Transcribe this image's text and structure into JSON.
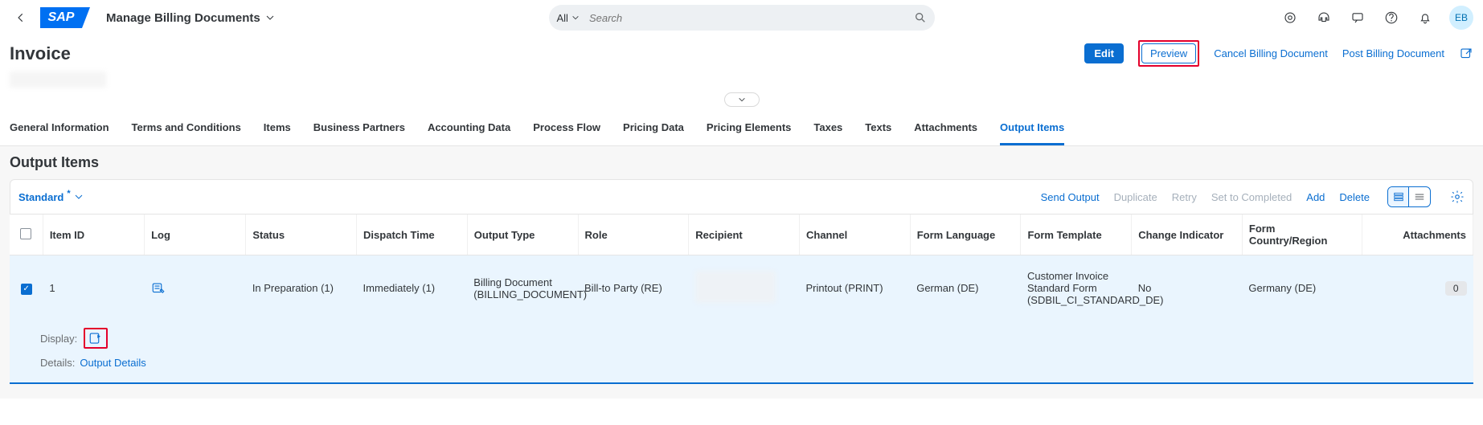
{
  "shell": {
    "logo_text": "SAP",
    "app_title": "Manage Billing Documents",
    "search_filter": "All",
    "search_placeholder": "Search",
    "avatar_initials": "EB"
  },
  "page": {
    "title": "Invoice"
  },
  "header_actions": {
    "edit": "Edit",
    "preview": "Preview",
    "cancel": "Cancel Billing Document",
    "post": "Post Billing Document"
  },
  "tabs": [
    "General Information",
    "Terms and Conditions",
    "Items",
    "Business Partners",
    "Accounting Data",
    "Process Flow",
    "Pricing Data",
    "Pricing Elements",
    "Taxes",
    "Texts",
    "Attachments",
    "Output Items"
  ],
  "active_tab_index": 11,
  "section": {
    "title": "Output Items",
    "variant": "Standard"
  },
  "toolbar": {
    "send_output": "Send Output",
    "duplicate": "Duplicate",
    "retry": "Retry",
    "set_completed": "Set to Completed",
    "add": "Add",
    "delete": "Delete"
  },
  "columns": [
    "Item ID",
    "Log",
    "Status",
    "Dispatch Time",
    "Output Type",
    "Role",
    "Recipient",
    "Channel",
    "Form Language",
    "Form Template",
    "Change Indicator",
    "Form Country/Region",
    "Attachments"
  ],
  "row": {
    "item_id": "1",
    "status": "In Preparation (1)",
    "dispatch_time": "Immediately (1)",
    "output_type": "Billing Document (BILLING_DOCUMENT)",
    "role": "Bill-to Party (RE)",
    "channel": "Printout (PRINT)",
    "form_language": "German (DE)",
    "form_template": "Customer Invoice Standard Form (SDBIL_CI_STANDARD_DE)",
    "change_indicator": "No",
    "form_country": "Germany (DE)",
    "attachments_count": "0"
  },
  "row_details": {
    "display_label": "Display:",
    "details_label": "Details:",
    "details_link": "Output Details"
  }
}
